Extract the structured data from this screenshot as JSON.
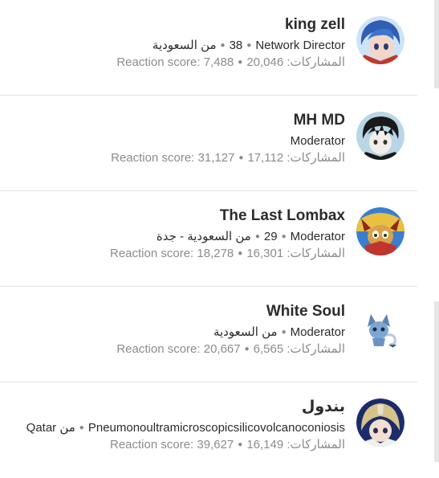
{
  "members": [
    {
      "username": "king zell",
      "avatar_icon": "anime-boy-blue-hair-avatar",
      "blurb": {
        "title": "Network Director",
        "age": "38",
        "location": "من السعودية"
      },
      "stats": {
        "messages_label": "المشاركات:",
        "messages_value": "20,046",
        "reaction_label": "Reaction score:",
        "reaction_value": "7,488"
      }
    },
    {
      "username": "MH MD",
      "avatar_icon": "anime-character-black-hair-avatar",
      "blurb": {
        "title": "Moderator"
      },
      "stats": {
        "messages_label": "المشاركات:",
        "messages_value": "17,112",
        "reaction_label": "Reaction score:",
        "reaction_value": "31,127"
      }
    },
    {
      "username": "The Last Lombax",
      "avatar_icon": "cartoon-character-avatar",
      "blurb": {
        "title": "Moderator",
        "age": "29",
        "location": "من السعودية - جدة"
      },
      "stats": {
        "messages_label": "المشاركات:",
        "messages_value": "16,301",
        "reaction_label": "Reaction score:",
        "reaction_value": "18,278"
      }
    },
    {
      "username": "White Soul",
      "avatar_icon": "small-creature-avatar",
      "blurb": {
        "title": "Moderator",
        "location": "من السعودية"
      },
      "stats": {
        "messages_label": "المشاركات:",
        "messages_value": "6,565",
        "reaction_label": "Reaction score:",
        "reaction_value": "20,667"
      }
    },
    {
      "username": "بندول",
      "avatar_icon": "anime-character-hooded-avatar",
      "blurb": {
        "title": "Pneumonoultramicroscopicsilicovolcanoconiosis",
        "location": "من Qatar"
      },
      "stats": {
        "messages_label": "المشاركات:",
        "messages_value": "16,149",
        "reaction_label": "Reaction score:",
        "reaction_value": "39,627"
      }
    }
  ]
}
